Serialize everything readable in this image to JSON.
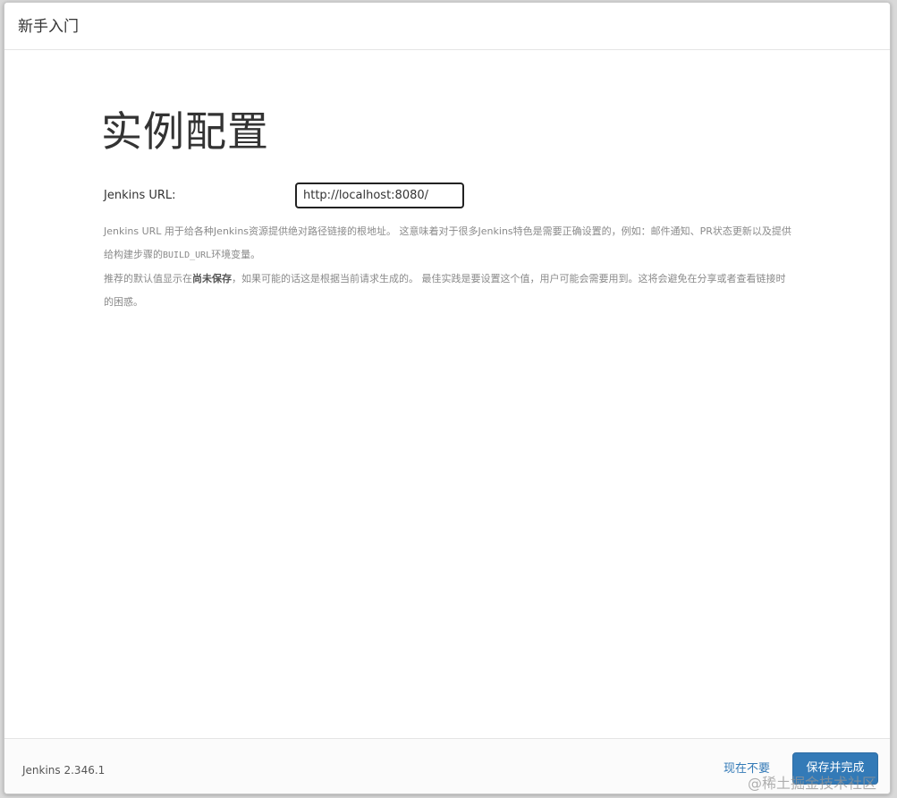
{
  "header": {
    "title": "新手入门"
  },
  "main": {
    "title": "实例配置",
    "url_label": "Jenkins URL:",
    "url_value": "http://localhost:8080/",
    "help": {
      "line1a": "Jenkins URL 用于给各种Jenkins资源提供绝对路径链接的根地址。 这意味着对于很多Jenkins特色是需要正确设置的，例如：邮件通知、PR状态更新以及提供给构建步骤的",
      "env_var": "BUILD_URL",
      "line1b": "环境变量。",
      "line2a": "推荐的默认值显示在",
      "line2_bold": "尚未保存",
      "line2b": "，如果可能的话这是根据当前请求生成的。 最佳实践是要设置这个值，用户可能会需要用到。这将会避免在分享或者查看链接时的困惑。"
    }
  },
  "footer": {
    "version": "Jenkins 2.346.1",
    "skip_label": "现在不要",
    "save_label": "保存并完成"
  },
  "watermark": "@稀土掘金技术社区",
  "colors": {
    "primary": "#337ab7",
    "text": "#333333",
    "muted": "#8a8a8a"
  }
}
